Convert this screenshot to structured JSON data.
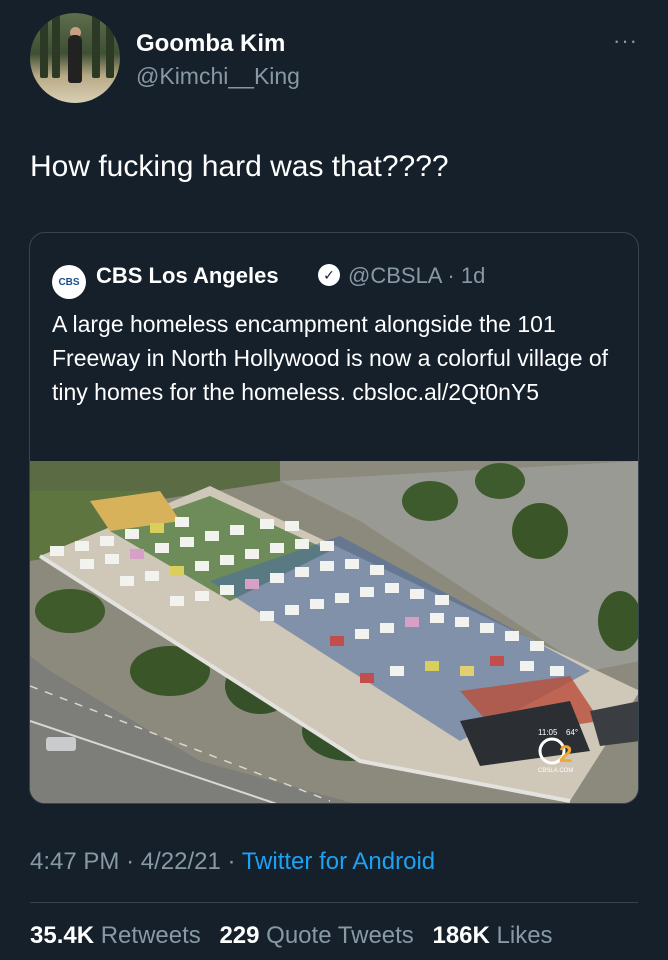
{
  "tweet": {
    "author_name": "Goomba Kim",
    "author_handle": "@Kimchi__King",
    "more_icon": "···",
    "text": "How fucking hard was that????",
    "time": "4:47 PM",
    "date": "4/22/21",
    "source": "Twitter for Android",
    "sep": "·"
  },
  "quoted": {
    "logo_text": "CBS",
    "author_name": "CBS Los Angeles",
    "verified_icon": "✓",
    "author_handle": "@CBSLA",
    "age": "1d",
    "text": "A large homeless encampment alongside the 101 Freeway in North Hollywood is now a colorful village of tiny homes for the homeless. cbsloc.al/2Qt0nY5",
    "photo": {
      "overlay_time": "11:05",
      "overlay_temp": "64°",
      "channel_logo": "2",
      "channel_label": "CBSLA.COM"
    }
  },
  "stats": {
    "retweets_count": "35.4K",
    "retweets_label": "Retweets",
    "quotes_count": "229",
    "quotes_label": "Quote Tweets",
    "likes_count": "186K",
    "likes_label": "Likes"
  },
  "colors": {
    "background": "#15202b",
    "secondary_text": "#8899a6",
    "link": "#1da1f2",
    "border": "#38444d"
  }
}
